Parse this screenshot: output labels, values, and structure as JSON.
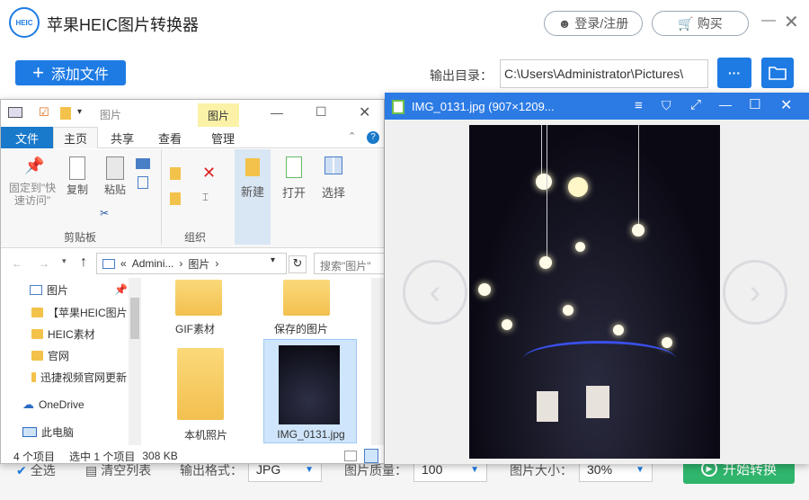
{
  "app": {
    "logo_text": "HEIC",
    "title": "苹果HEIC图片转换器",
    "login": "登录/注册",
    "buy": "购买",
    "add_file": "添加文件",
    "output_label": "输出目录：",
    "output_path": "C:\\Users\\Administrator\\Pictures\\",
    "more_btn": "···",
    "bottom": {
      "select_all": "全选",
      "clear_list": "清空列表",
      "format_label": "输出格式：",
      "format_value": "JPG",
      "quality_label": "图片质量：",
      "quality_value": "100",
      "size_label": "图片大小：",
      "size_value": "30%",
      "start": "开始转换"
    }
  },
  "explorer": {
    "title": "图片",
    "context_tab": "图片",
    "tabs": [
      "文件",
      "主页",
      "共享",
      "查看",
      "管理"
    ],
    "ribbon": {
      "pin": "固定到\"快速访问\"",
      "copy": "复制",
      "paste": "粘贴",
      "clipboard_group": "剪贴板",
      "organize_group": "组织",
      "new": "新建",
      "open": "打开",
      "select": "选择"
    },
    "address": {
      "prefix": "«",
      "crumb1": "Admini...",
      "crumb2": "图片"
    },
    "search_placeholder": "搜索\"图片\"",
    "nav_items": [
      "图片",
      "【苹果HEIC图片",
      "HEIC素材",
      "官网",
      "迅捷视频官网更新"
    ],
    "onedrive": "OneDrive",
    "this_pc": "此电脑",
    "files": [
      "GIF素材",
      "保存的图片",
      "本机照片",
      "IMG_0131.jpg"
    ],
    "status": {
      "count": "4 个项目",
      "selected": "选中 1 个项目",
      "size": "308 KB"
    }
  },
  "viewer": {
    "title": "IMG_0131.jpg  (907×1209..."
  }
}
